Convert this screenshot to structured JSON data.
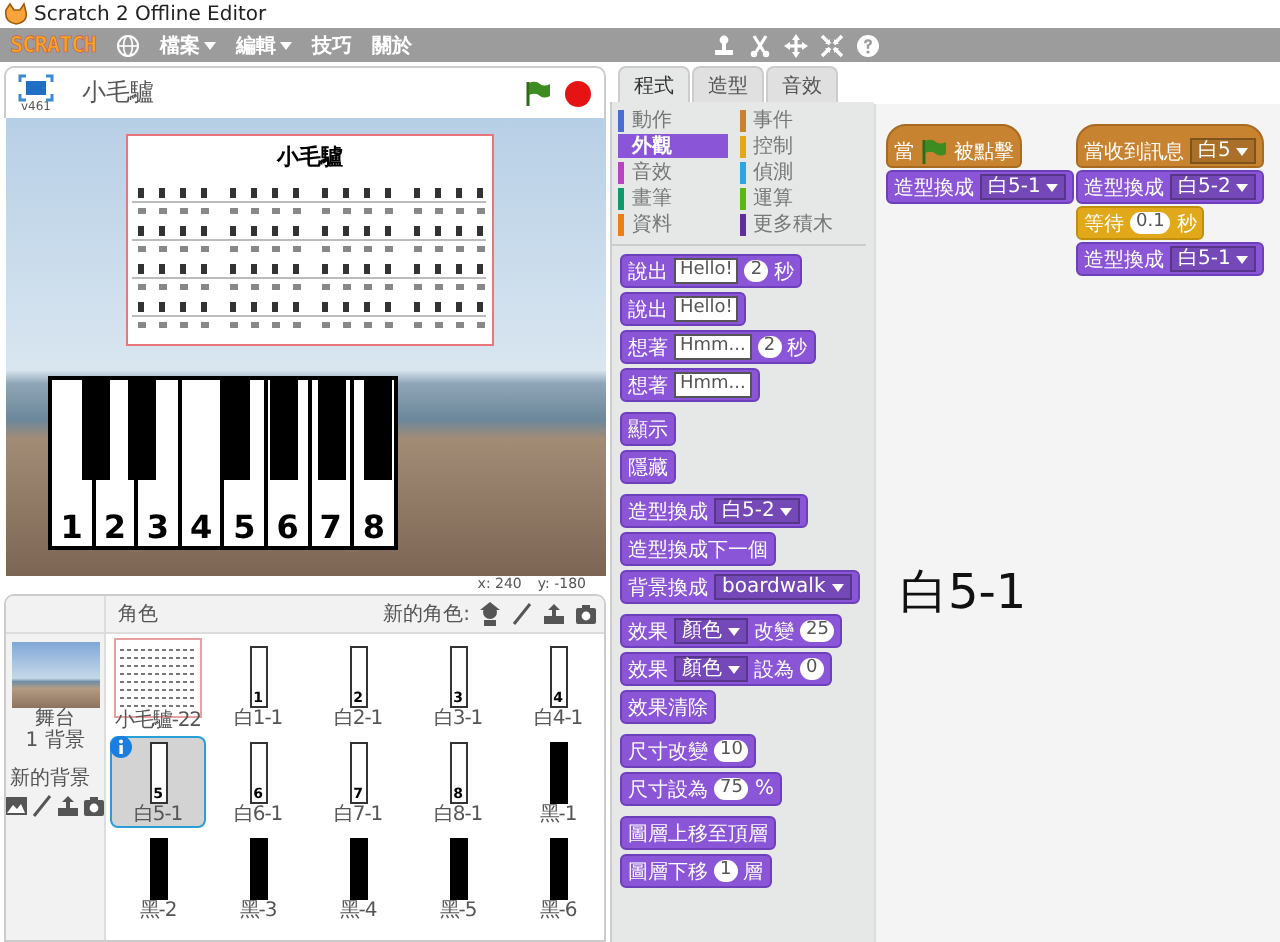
{
  "window": {
    "title": "Scratch 2 Offline Editor"
  },
  "menu_bar": {
    "logo": "SCRATCH",
    "menus": [
      {
        "label": "檔案",
        "dropdown": true
      },
      {
        "label": "編輯",
        "dropdown": true
      },
      {
        "label": "技巧",
        "dropdown": false
      },
      {
        "label": "關於",
        "dropdown": false
      }
    ]
  },
  "stage": {
    "version": "v461",
    "project_title": "小毛驢",
    "sheet_title": "小毛驢",
    "mouse_x": "x: 240",
    "mouse_y": "y: -180",
    "piano_keys": [
      {
        "kind": "white",
        "label": "1"
      },
      {
        "kind": "black"
      },
      {
        "kind": "white",
        "label": "2"
      },
      {
        "kind": "black"
      },
      {
        "kind": "white",
        "label": "3"
      },
      {
        "kind": "white",
        "label": "4"
      },
      {
        "kind": "black"
      },
      {
        "kind": "white",
        "label": "5"
      },
      {
        "kind": "black"
      },
      {
        "kind": "white",
        "label": "6"
      },
      {
        "kind": "black"
      },
      {
        "kind": "white",
        "label": "7"
      },
      {
        "kind": "black"
      },
      {
        "kind": "white",
        "label": "8"
      }
    ]
  },
  "sprites": {
    "header": "角色",
    "new_label": "新的角色:",
    "stage_label": "舞台",
    "backdrop_count": "1 背景",
    "new_backdrop": "新的背景",
    "items": [
      {
        "name": "小毛驢-22",
        "kind": "sheet",
        "selected": false
      },
      {
        "name": "白1-1",
        "kind": "white",
        "number": "1",
        "selected": false
      },
      {
        "name": "白2-1",
        "kind": "white",
        "number": "2",
        "selected": false
      },
      {
        "name": "白3-1",
        "kind": "white",
        "number": "3",
        "selected": false
      },
      {
        "name": "白4-1",
        "kind": "white",
        "number": "4",
        "selected": false
      },
      {
        "name": "白5-1",
        "kind": "white",
        "number": "5",
        "selected": true
      },
      {
        "name": "白6-1",
        "kind": "white",
        "number": "6",
        "selected": false
      },
      {
        "name": "白7-1",
        "kind": "white",
        "number": "7",
        "selected": false
      },
      {
        "name": "白8-1",
        "kind": "white",
        "number": "8",
        "selected": false
      },
      {
        "name": "黑-1",
        "kind": "black",
        "selected": false
      },
      {
        "name": "黑-2",
        "kind": "black",
        "selected": false
      },
      {
        "name": "黑-3",
        "kind": "black",
        "selected": false
      },
      {
        "name": "黑-4",
        "kind": "black",
        "selected": false
      },
      {
        "name": "黑-5",
        "kind": "black",
        "selected": false
      },
      {
        "name": "黑-6",
        "kind": "black",
        "selected": false
      }
    ]
  },
  "tabs": [
    {
      "label": "程式",
      "selected": true
    },
    {
      "label": "造型",
      "selected": false
    },
    {
      "label": "音效",
      "selected": false
    }
  ],
  "categories": [
    {
      "label": "動作",
      "color": "#4a6cd4",
      "selected": false
    },
    {
      "label": "事件",
      "color": "#c88330",
      "selected": false
    },
    {
      "label": "外觀",
      "color": "#8a55d7",
      "selected": true
    },
    {
      "label": "控制",
      "color": "#e1a91a",
      "selected": false
    },
    {
      "label": "音效",
      "color": "#bb42c3",
      "selected": false
    },
    {
      "label": "偵測",
      "color": "#2ca5e2",
      "selected": false
    },
    {
      "label": "畫筆",
      "color": "#0e9a6c",
      "selected": false
    },
    {
      "label": "運算",
      "color": "#5cb712",
      "selected": false
    },
    {
      "label": "資料",
      "color": "#ee7d16",
      "selected": false
    },
    {
      "label": "更多積木",
      "color": "#632d99",
      "selected": false
    }
  ],
  "palette": [
    [
      {
        "kind": "looks",
        "parts": [
          {
            "kind": "text",
            "text": "說出"
          },
          {
            "kind": "string",
            "text": "Hello!"
          },
          {
            "kind": "number",
            "text": "2"
          },
          {
            "kind": "text",
            "text": "秒"
          }
        ]
      },
      {
        "kind": "looks",
        "parts": [
          {
            "kind": "text",
            "text": "說出"
          },
          {
            "kind": "string",
            "text": "Hello!"
          }
        ]
      },
      {
        "kind": "looks",
        "parts": [
          {
            "kind": "text",
            "text": "想著"
          },
          {
            "kind": "string",
            "text": "Hmm..."
          },
          {
            "kind": "number",
            "text": "2"
          },
          {
            "kind": "text",
            "text": "秒"
          }
        ]
      },
      {
        "kind": "looks",
        "parts": [
          {
            "kind": "text",
            "text": "想著"
          },
          {
            "kind": "string",
            "text": "Hmm..."
          }
        ]
      }
    ],
    [
      {
        "kind": "looks",
        "parts": [
          {
            "kind": "text",
            "text": "顯示"
          }
        ]
      },
      {
        "kind": "looks",
        "parts": [
          {
            "kind": "text",
            "text": "隱藏"
          }
        ]
      }
    ],
    [
      {
        "kind": "looks",
        "parts": [
          {
            "kind": "text",
            "text": "造型換成"
          },
          {
            "kind": "menu",
            "text": "白5-2"
          }
        ]
      },
      {
        "kind": "looks",
        "parts": [
          {
            "kind": "text",
            "text": "造型換成下一個"
          }
        ]
      },
      {
        "kind": "looks",
        "parts": [
          {
            "kind": "text",
            "text": "背景換成"
          },
          {
            "kind": "menu",
            "text": "boardwalk"
          }
        ]
      }
    ],
    [
      {
        "kind": "looks",
        "parts": [
          {
            "kind": "text",
            "text": "效果"
          },
          {
            "kind": "menu",
            "text": "顏色"
          },
          {
            "kind": "text",
            "text": "改變"
          },
          {
            "kind": "number",
            "text": "25"
          }
        ]
      },
      {
        "kind": "looks",
        "parts": [
          {
            "kind": "text",
            "text": "效果"
          },
          {
            "kind": "menu",
            "text": "顏色"
          },
          {
            "kind": "text",
            "text": "設為"
          },
          {
            "kind": "number",
            "text": "0"
          }
        ]
      },
      {
        "kind": "looks",
        "parts": [
          {
            "kind": "text",
            "text": "效果清除"
          }
        ]
      }
    ],
    [
      {
        "kind": "looks",
        "parts": [
          {
            "kind": "text",
            "text": "尺寸改變"
          },
          {
            "kind": "number",
            "text": "10"
          }
        ]
      },
      {
        "kind": "looks",
        "parts": [
          {
            "kind": "text",
            "text": "尺寸設為"
          },
          {
            "kind": "number",
            "text": "75"
          },
          {
            "kind": "text",
            "text": "%"
          }
        ]
      }
    ],
    [
      {
        "kind": "looks",
        "parts": [
          {
            "kind": "text",
            "text": "圖層上移至頂層"
          }
        ]
      },
      {
        "kind": "looks",
        "parts": [
          {
            "kind": "text",
            "text": "圖層下移"
          },
          {
            "kind": "number",
            "text": "1"
          },
          {
            "kind": "text",
            "text": "層"
          }
        ]
      }
    ]
  ],
  "scripts": [
    [
      {
        "kind": "events-hat",
        "parts": [
          {
            "kind": "text",
            "text": "當"
          },
          {
            "kind": "flag"
          },
          {
            "kind": "text",
            "text": "被點擊"
          }
        ]
      },
      {
        "kind": "looks",
        "parts": [
          {
            "kind": "text",
            "text": "造型換成"
          },
          {
            "kind": "menu",
            "text": "白5-1"
          }
        ]
      }
    ],
    [
      {
        "kind": "events-hat",
        "parts": [
          {
            "kind": "text",
            "text": "當收到訊息"
          },
          {
            "kind": "menu",
            "text": "白5"
          }
        ]
      },
      {
        "kind": "looks",
        "parts": [
          {
            "kind": "text",
            "text": "造型換成"
          },
          {
            "kind": "menu",
            "text": "白5-2"
          }
        ]
      },
      {
        "kind": "control",
        "parts": [
          {
            "kind": "text",
            "text": "等待"
          },
          {
            "kind": "number",
            "text": "0.1"
          },
          {
            "kind": "text",
            "text": "秒"
          }
        ]
      },
      {
        "kind": "looks",
        "parts": [
          {
            "kind": "text",
            "text": "造型換成"
          },
          {
            "kind": "menu",
            "text": "白5-1"
          }
        ]
      }
    ]
  ],
  "scripts_note": "白5-1"
}
